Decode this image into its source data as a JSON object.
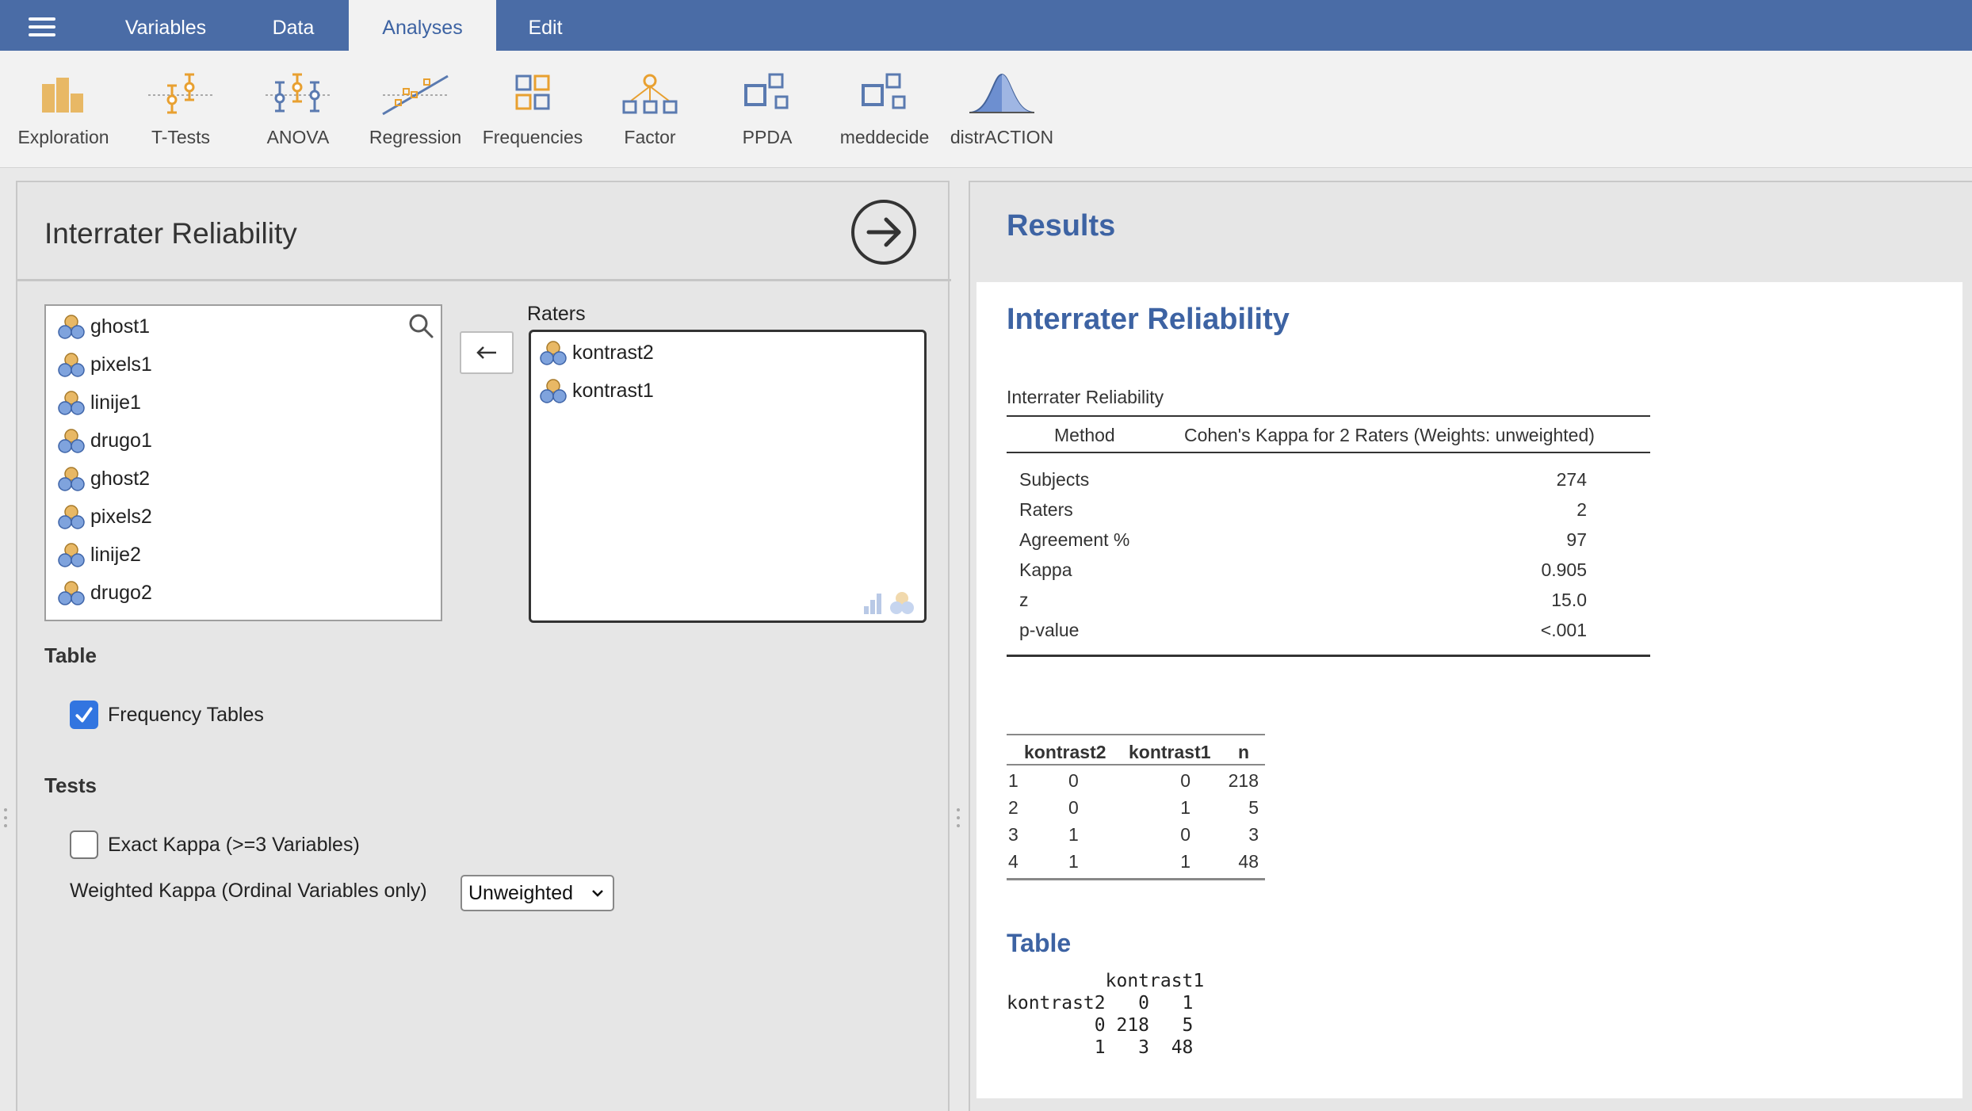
{
  "menu": {
    "tabs": [
      {
        "label": "Variables"
      },
      {
        "label": "Data"
      },
      {
        "label": "Analyses"
      },
      {
        "label": "Edit"
      }
    ],
    "active_tab": "Analyses"
  },
  "ribbon": {
    "items": [
      {
        "label": "Exploration",
        "icon": "exploration-icon"
      },
      {
        "label": "T-Tests",
        "icon": "t-tests-icon"
      },
      {
        "label": "ANOVA",
        "icon": "anova-icon"
      },
      {
        "label": "Regression",
        "icon": "regression-icon"
      },
      {
        "label": "Frequencies",
        "icon": "frequencies-icon"
      },
      {
        "label": "Factor",
        "icon": "factor-icon"
      },
      {
        "label": "PPDA",
        "icon": "ppda-icon"
      },
      {
        "label": "meddecide",
        "icon": "meddecide-icon"
      },
      {
        "label": "distrACTION",
        "icon": "distraction-icon"
      }
    ]
  },
  "options": {
    "title": "Interrater Reliability",
    "variables": [
      "ghost1",
      "pixels1",
      "linije1",
      "drugo1",
      "ghost2",
      "pixels2",
      "linije2",
      "drugo2"
    ],
    "raters_label": "Raters",
    "raters": [
      "kontrast2",
      "kontrast1"
    ],
    "table_section": "Table",
    "frequency_tables_label": "Frequency Tables",
    "frequency_tables_checked": true,
    "tests_section": "Tests",
    "exact_kappa_label": "Exact Kappa (>=3 Variables)",
    "exact_kappa_checked": false,
    "weighted_kappa_label": "Weighted Kappa (Ordinal Variables only)",
    "weighted_kappa_value": "Unweighted"
  },
  "results": {
    "heading": "Results",
    "analysis_title": "Interrater Reliability",
    "main_table": {
      "caption": "Interrater Reliability",
      "col_method": "Method",
      "col_value": "Cohen's Kappa for 2 Raters (Weights: unweighted)",
      "rows": [
        {
          "label": "Subjects",
          "value": "274"
        },
        {
          "label": "Raters",
          "value": "2"
        },
        {
          "label": "Agreement %",
          "value": "97"
        },
        {
          "label": "Kappa",
          "value": "0.905"
        },
        {
          "label": "z",
          "value": "15.0"
        },
        {
          "label": "p-value",
          "value": "<.001"
        }
      ]
    },
    "freq_table": {
      "headers": [
        "kontrast2",
        "kontrast1",
        "n"
      ],
      "rows": [
        [
          "1",
          "0",
          "0",
          "218"
        ],
        [
          "2",
          "0",
          "1",
          "5"
        ],
        [
          "3",
          "1",
          "0",
          "3"
        ],
        [
          "4",
          "1",
          "1",
          "48"
        ]
      ]
    },
    "table_section_title": "Table",
    "crosstab_text": "         kontrast1\nkontrast2   0   1\n        0 218   5\n        1   3  48"
  },
  "colors": {
    "topbar": "#4a6ca6",
    "accent_blue": "#3d63a3",
    "checkbox_blue": "#3275e0"
  }
}
